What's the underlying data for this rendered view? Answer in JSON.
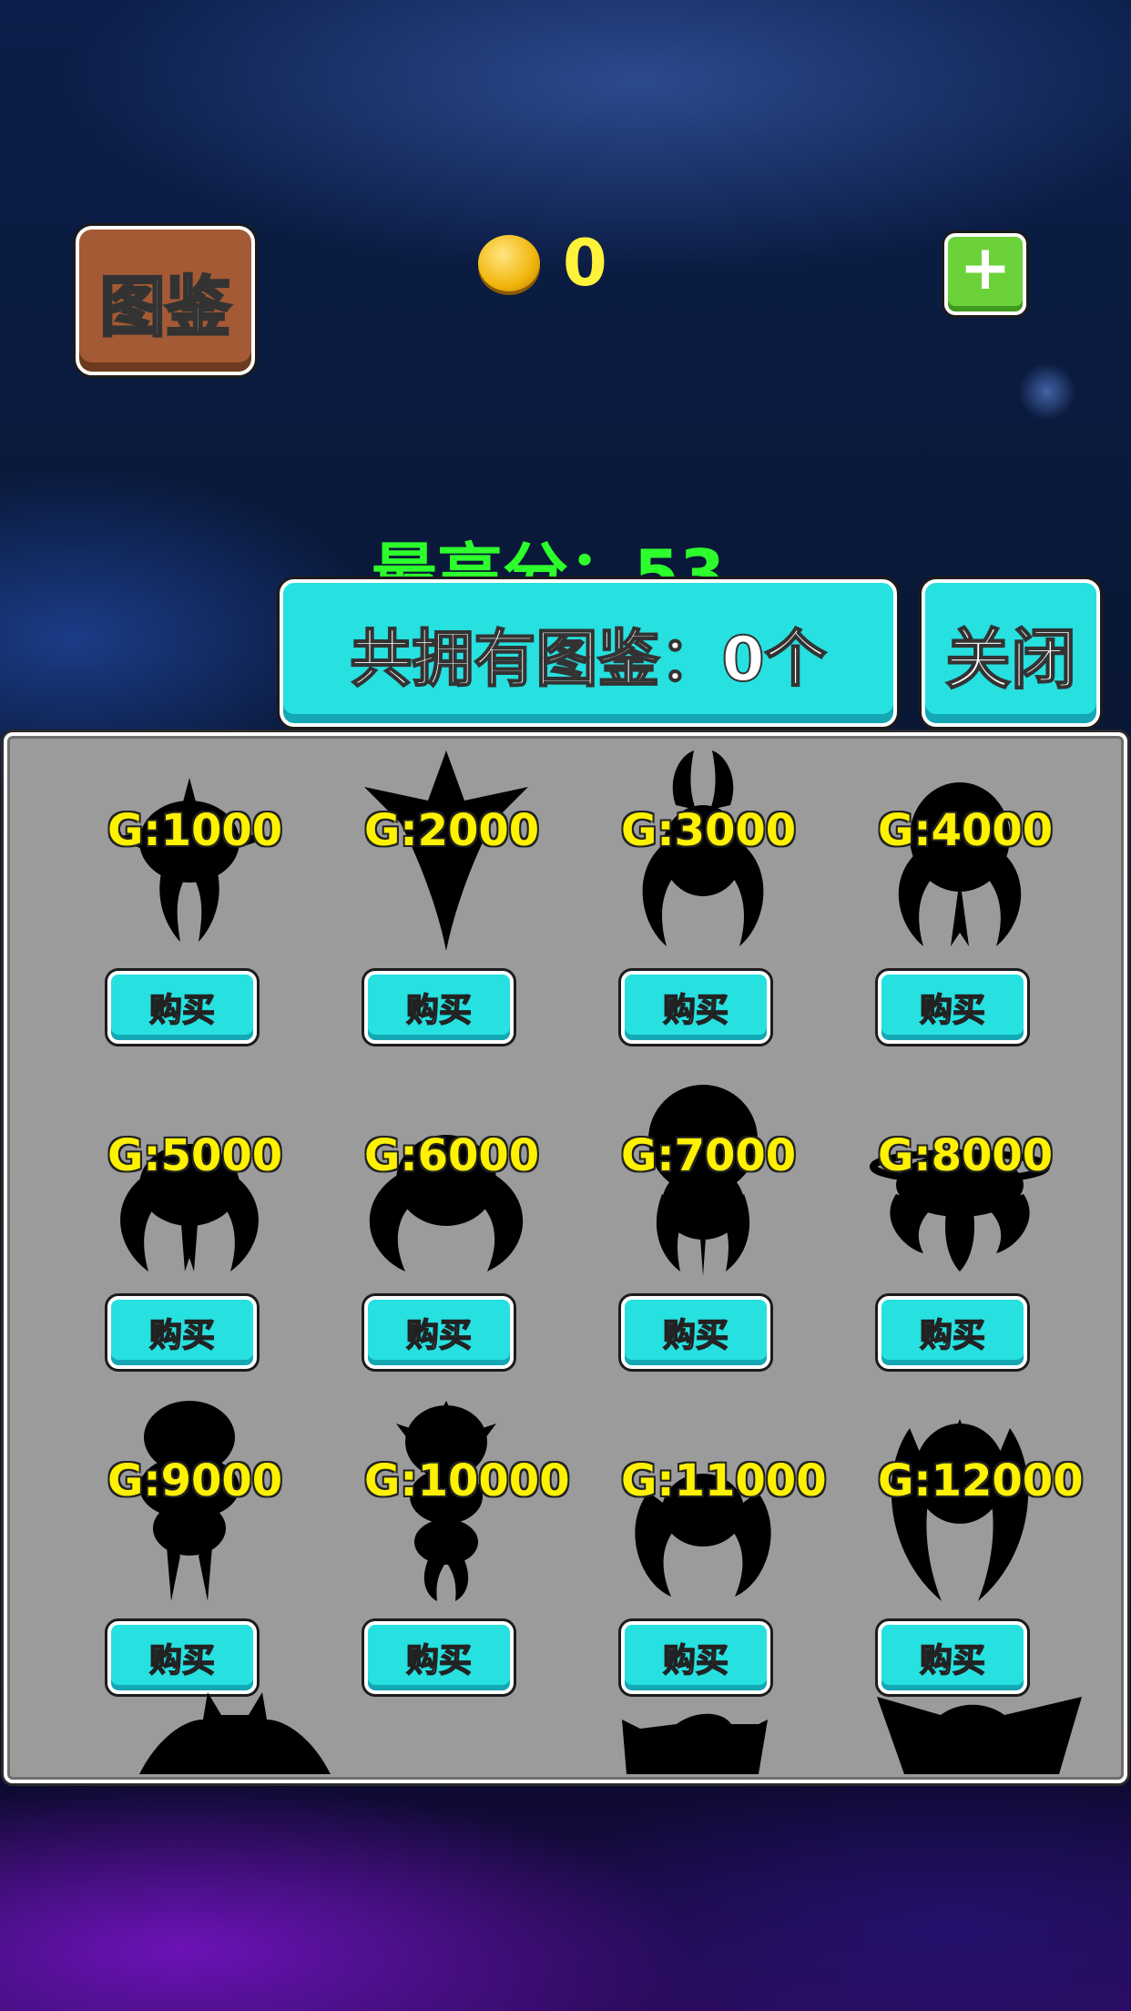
{
  "header": {
    "book_label": "图鉴",
    "coins": "0",
    "add_label": "+",
    "best_score": "最高分：53"
  },
  "collection": {
    "owned_label": "共拥有图鉴：0个",
    "close_label": "关闭"
  },
  "items": [
    {
      "price": "G:1000",
      "buy_label": "购买",
      "icon": "monster-1-icon"
    },
    {
      "price": "G:2000",
      "buy_label": "购买",
      "icon": "monster-2-icon"
    },
    {
      "price": "G:3000",
      "buy_label": "购买",
      "icon": "monster-3-icon"
    },
    {
      "price": "G:4000",
      "buy_label": "购买",
      "icon": "monster-4-icon"
    },
    {
      "price": "G:5000",
      "buy_label": "购买",
      "icon": "monster-5-icon"
    },
    {
      "price": "G:6000",
      "buy_label": "购买",
      "icon": "monster-6-icon"
    },
    {
      "price": "G:7000",
      "buy_label": "购买",
      "icon": "monster-7-icon"
    },
    {
      "price": "G:8000",
      "buy_label": "购买",
      "icon": "monster-8-icon"
    },
    {
      "price": "G:9000",
      "buy_label": "购买",
      "icon": "monster-9-icon"
    },
    {
      "price": "G:10000",
      "buy_label": "购买",
      "icon": "monster-10-icon"
    },
    {
      "price": "G:11000",
      "buy_label": "购买",
      "icon": "monster-11-icon"
    },
    {
      "price": "G:12000",
      "buy_label": "购买",
      "icon": "monster-12-icon"
    }
  ],
  "colors": {
    "button_cyan": "#27e0e0",
    "price_yellow": "#fff200",
    "score_green": "#2cff2c",
    "panel_gray": "#9b9b9b"
  }
}
